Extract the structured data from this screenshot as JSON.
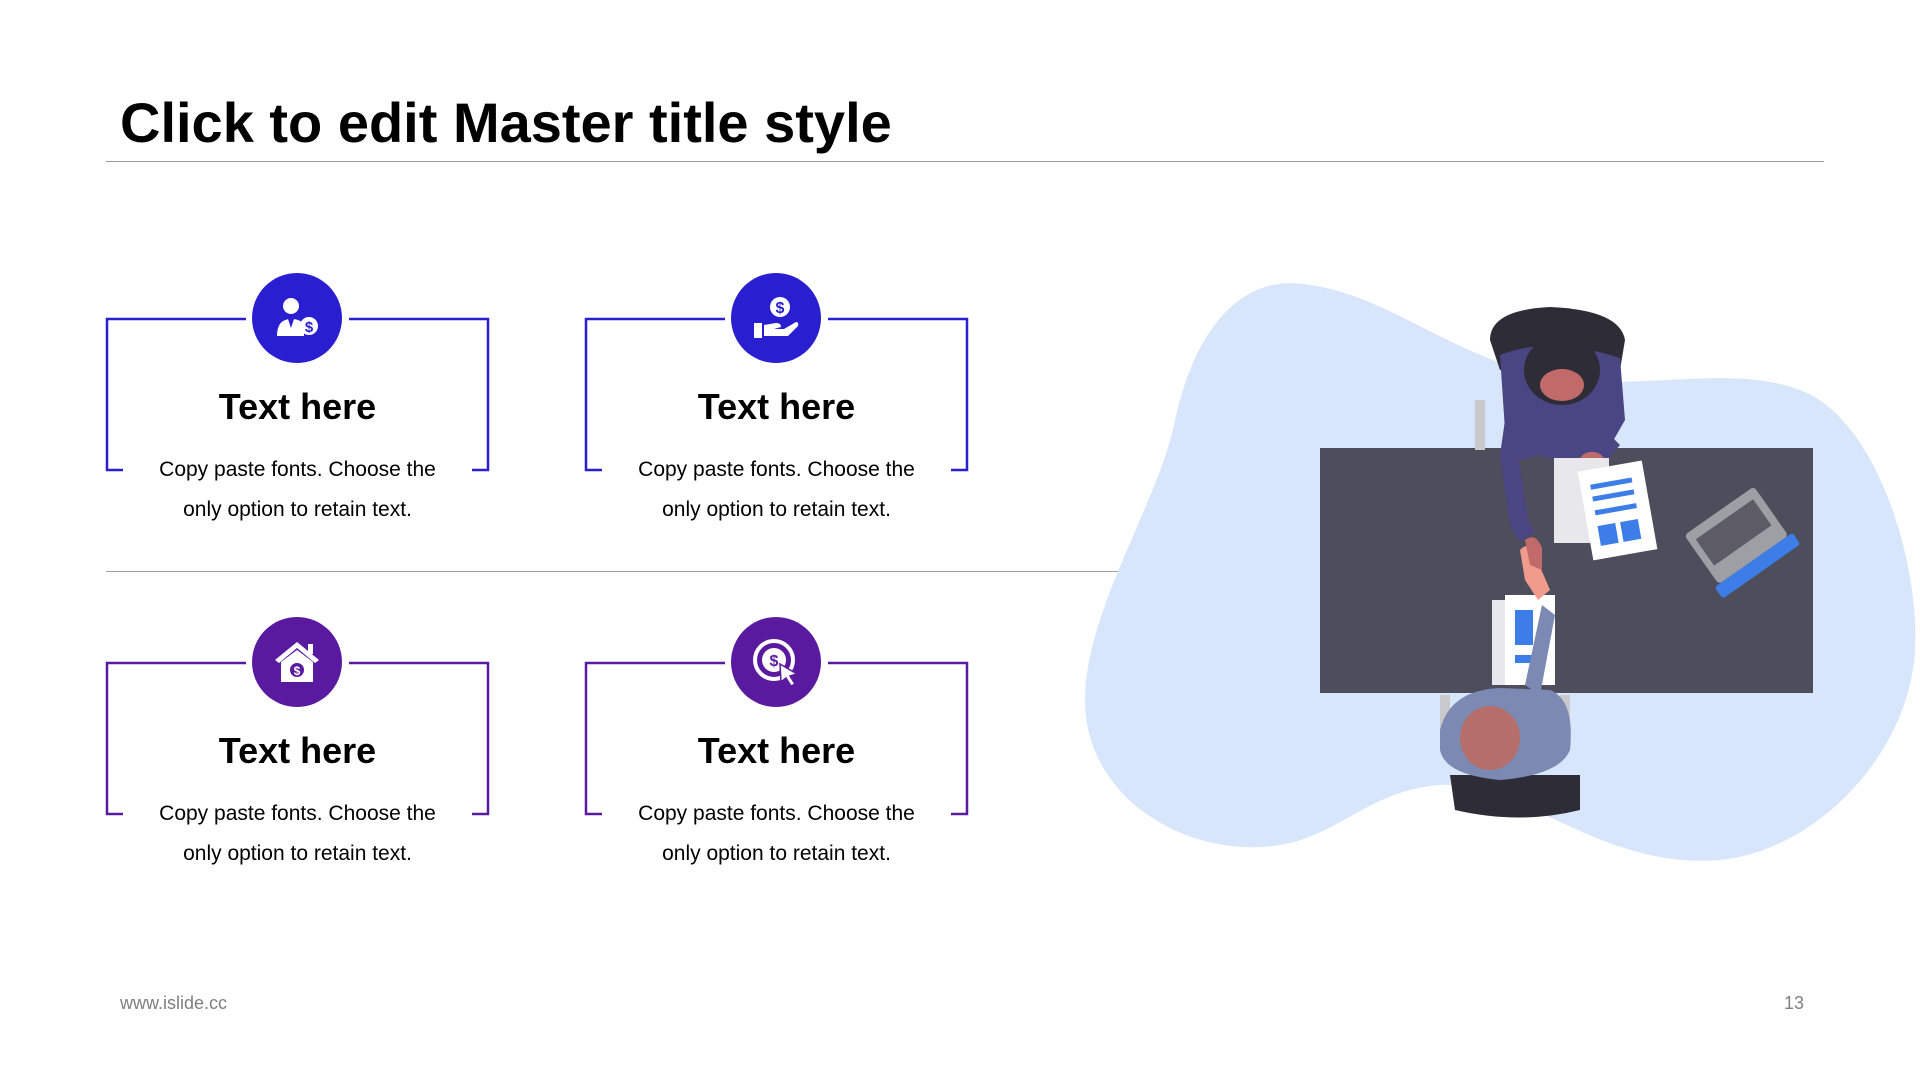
{
  "title": "Click to edit Master title style",
  "footer": {
    "url": "www.islide.cc",
    "page_number": "13"
  },
  "colors": {
    "blue_accent": "#2a1fd0",
    "purple_accent": "#5a1aa0",
    "blob": "#d8e6fc",
    "desk": "#4e4d5c"
  },
  "cards": [
    {
      "icon": "businessman-dollar-icon",
      "heading": "Text here",
      "body_line1": "Copy paste fonts. Choose the",
      "body_line2": "only option to retain text."
    },
    {
      "icon": "hand-holding-dollar-icon",
      "heading": "Text here",
      "body_line1": "Copy paste fonts. Choose the",
      "body_line2": "only option to retain text."
    },
    {
      "icon": "house-dollar-icon",
      "heading": "Text here",
      "body_line1": "Copy paste fonts. Choose the",
      "body_line2": "only option to retain text."
    },
    {
      "icon": "dollar-click-icon",
      "heading": "Text here",
      "body_line1": "Copy paste fonts. Choose the",
      "body_line2": "only option to retain text."
    }
  ],
  "illustration": {
    "name": "handshake-meeting-illustration"
  }
}
